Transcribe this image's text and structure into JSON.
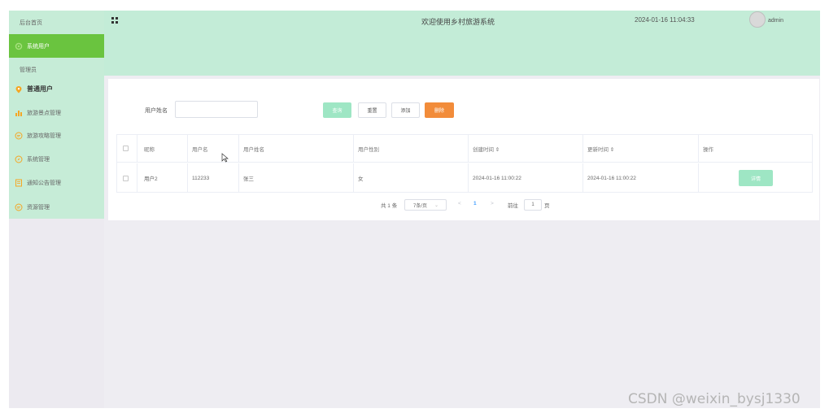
{
  "sidebar": {
    "items": [
      {
        "label": "后台首页",
        "icon": ""
      },
      {
        "label": "系统用户",
        "icon": "gear-icon"
      },
      {
        "label": "管理员",
        "icon": ""
      },
      {
        "label": "普通用户",
        "icon": "location-pin-icon"
      },
      {
        "label": "旅游景点管理",
        "icon": "bar-chart-icon"
      },
      {
        "label": "旅游攻略管理",
        "icon": "chat-icon"
      },
      {
        "label": "系统管理",
        "icon": "compass-icon"
      },
      {
        "label": "通知公告管理",
        "icon": "document-icon"
      },
      {
        "label": "资源管理",
        "icon": "chat-icon"
      }
    ]
  },
  "header": {
    "title": "欢迎使用乡村旅游系统",
    "datetime": "2024-01-16 11:04:33",
    "username": "admin"
  },
  "search": {
    "label": "用户姓名",
    "value": "",
    "query_label": "查询",
    "reset_label": "重置",
    "add_label": "添加",
    "delete_label": "删除"
  },
  "table": {
    "columns": [
      "昵称",
      "用户名",
      "用户姓名",
      "用户性别",
      "创建时间 ⇕",
      "更新时间 ⇕",
      "操作"
    ],
    "rows": [
      {
        "nickname": "用户2",
        "username": "112233",
        "realname": "张三",
        "gender": "女",
        "created": "2024-01-16 11:00:22",
        "updated": "2024-01-16 11:00:22",
        "action": "详情"
      }
    ]
  },
  "pagination": {
    "total": "共 1 条",
    "page_size": "7条/页",
    "prev": "<",
    "current": "1",
    "next": ">",
    "goto_label": "前往",
    "goto_value": "1",
    "page_suffix": "页"
  },
  "watermark": "CSDN @weixin_bysj1330",
  "colors": {
    "header_bg": "#c3ecd7",
    "sidebar_active": "#6ac43f",
    "query_btn": "#9ee6c4",
    "delete_btn": "#f28c3a"
  }
}
